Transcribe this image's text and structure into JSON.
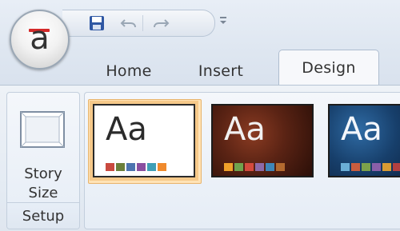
{
  "app": {
    "logo_letter": "a",
    "accent": "#d42a2a"
  },
  "quick_access": {
    "icons": [
      "save-icon",
      "undo-icon",
      "redo-icon",
      "customize-icon"
    ]
  },
  "tabs": [
    {
      "label": "Home",
      "selected": false
    },
    {
      "label": "Insert",
      "selected": false
    },
    {
      "label": "Design",
      "selected": true
    }
  ],
  "ribbon": {
    "setup_group": {
      "button_label_line1": "Story",
      "button_label_line2": "Size",
      "group_label": "Setup",
      "icon": "story-size-icon"
    },
    "themes": [
      {
        "sample": "Aa",
        "selected": true,
        "background": "#ffffff",
        "text_color": "#2b2b2b",
        "swatches": [
          "#c94a3f",
          "#6b7f3a",
          "#4d74b0",
          "#8a4fa0",
          "#3f9fb6",
          "#f08a2c"
        ]
      },
      {
        "sample": "Aa",
        "selected": false,
        "background": "#5a2314",
        "text_color": "#f1f1f1",
        "swatches": [
          "#f0a12a",
          "#6fa34e",
          "#d44a3d",
          "#8c6aa8",
          "#3e86b8",
          "#b36a2f"
        ]
      },
      {
        "sample": "Aa",
        "selected": false,
        "background": "#173f6b",
        "text_color": "#f3f6fb",
        "swatches": [
          "#6aaed6",
          "#c95d3e",
          "#7ca14a",
          "#8a5fa8",
          "#d89b33",
          "#b34040"
        ]
      }
    ]
  }
}
